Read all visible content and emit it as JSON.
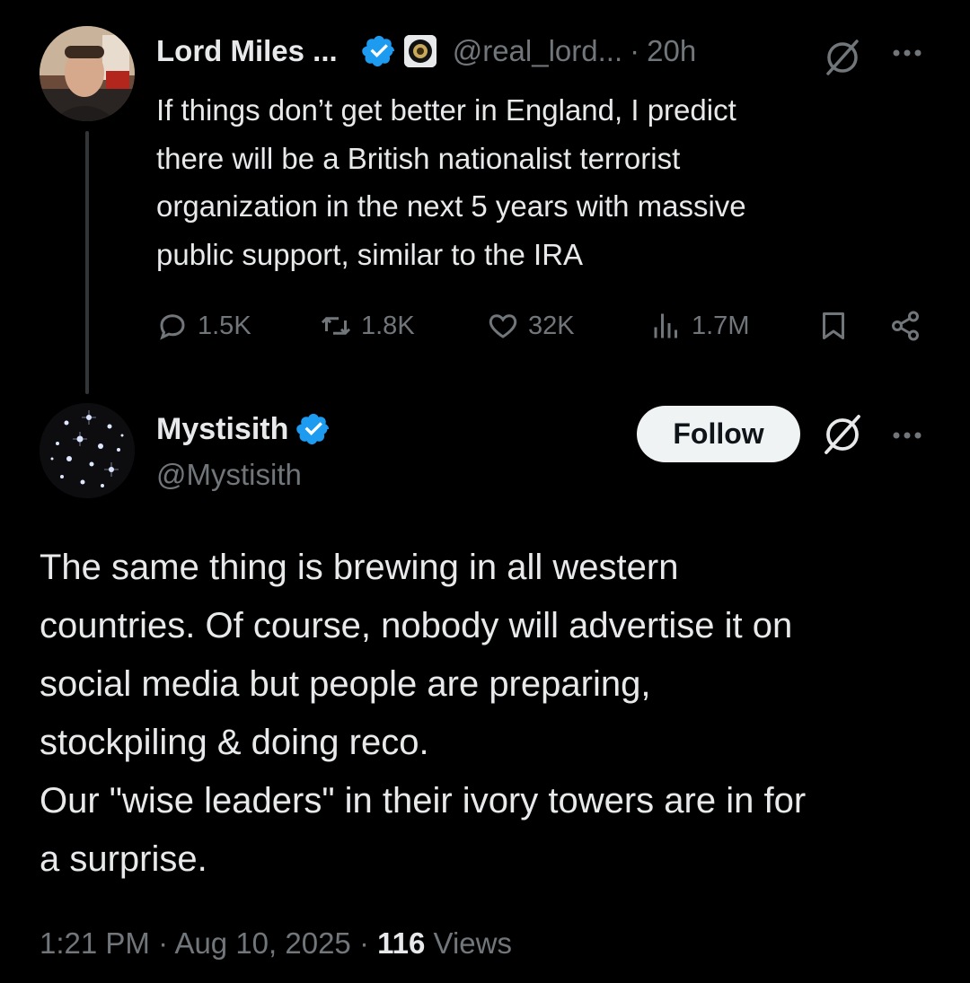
{
  "parent_tweet": {
    "author_name": "Lord Miles ...",
    "handle": "@real_lord...",
    "separator": "·",
    "time": "20h",
    "text_lines": [
      "If things don’t get better in England, I predict",
      "there will be a British nationalist terrorist",
      "organization in the next 5 years with massive",
      "public support, similar to the IRA"
    ],
    "replies": "1.5K",
    "reposts": "1.8K",
    "likes": "32K",
    "views": "1.7M"
  },
  "reply_tweet": {
    "author_name": "Mystisith",
    "handle": "@Mystisith",
    "follow_label": "Follow",
    "text_lines": [
      "The same thing is brewing in all western",
      "countries. Of course, nobody will advertise it on",
      "social media but people are preparing,",
      "stockpiling & doing reco.",
      "Our \"wise leaders\" in their ivory towers are in for",
      "a surprise."
    ]
  },
  "footer": {
    "time": "1:21 PM",
    "sep1": "·",
    "date": "Aug 10, 2025",
    "sep2": "·",
    "views_count": "116",
    "views_label": "Views"
  },
  "colors": {
    "background": "#000000",
    "primary_text": "#e7e9ea",
    "secondary_text": "#71767b",
    "verified_blue": "#1d9bf0",
    "thread_line": "#333639",
    "follow_bg": "#eff3f4"
  }
}
